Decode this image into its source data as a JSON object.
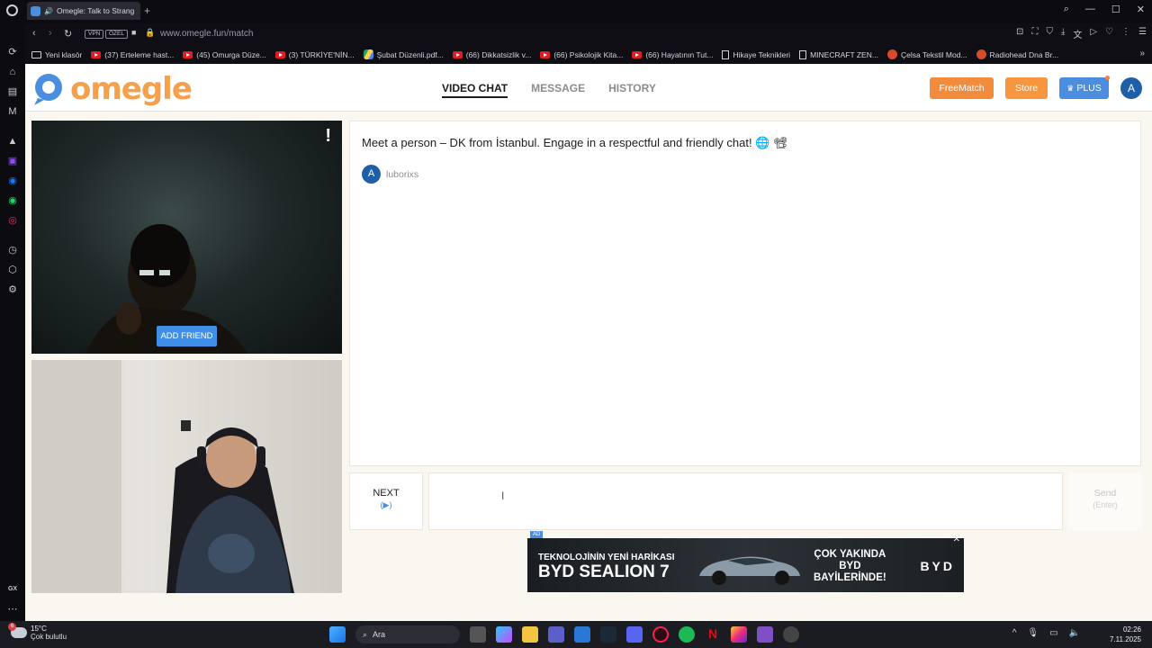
{
  "browser": {
    "tab_title": "Omegle: Talk to Strang",
    "url": "www.omegle.fun/match",
    "vpn_label": "VPN",
    "private_label": "ÖZEL",
    "bookmarks": [
      {
        "label": "Yeni klasör",
        "icon": "folder-icon"
      },
      {
        "label": "(37) Erteleme hast...",
        "icon": "youtube-icon"
      },
      {
        "label": "(45) Omurga Düze...",
        "icon": "youtube-icon"
      },
      {
        "label": "(3) TÜRKİYE'NİN...",
        "icon": "youtube-icon"
      },
      {
        "label": "Şubat Düzenli.pdf...",
        "icon": "drive-icon"
      },
      {
        "label": "(66) Dikkatsizlik v...",
        "icon": "youtube-icon"
      },
      {
        "label": "(66) Psikolojik Kita...",
        "icon": "youtube-icon"
      },
      {
        "label": "(66) Hayatının Tut...",
        "icon": "youtube-icon"
      },
      {
        "label": "Hikaye Teknikleri",
        "icon": "document-icon"
      },
      {
        "label": "MINECRAFT ZEN...",
        "icon": "document-icon"
      },
      {
        "label": "Çelsa Tekstil Mod...",
        "icon": "site-icon"
      },
      {
        "label": "Radiohead Dna Br...",
        "icon": "site-icon"
      }
    ],
    "sidebar_label": "GX"
  },
  "site": {
    "logo_text": "omegle",
    "nav": {
      "video_chat": "VIDEO CHAT",
      "message": "MESSAGE",
      "history": "HISTORY"
    },
    "buttons": {
      "freematch": "FreeMatch",
      "store": "Store",
      "plus": "PLUS"
    },
    "avatar_letter": "A",
    "colors": {
      "brand_orange": "#f7a04c",
      "accent_blue": "#3f8fe6",
      "avatar_blue": "#1f5fa8"
    }
  },
  "video": {
    "report_symbol": "!",
    "add_friend": "ADD FRIEND"
  },
  "chat": {
    "intro": "Meet a person – DK from İstanbul. Engage in a respectful and friendly chat! 🌐 📽",
    "user_letter": "A",
    "user_name": "luborixs",
    "next_label": "NEXT",
    "next_hint": "(▶)",
    "send_label": "Send",
    "send_hint": "(Enter)"
  },
  "ad": {
    "tag": "AD",
    "close": "✕",
    "line1": "TEKNOLOJİNİN YENİ HARİKASI",
    "line2": "BYD SEALION 7",
    "right_1": "ÇOK YAKINDA",
    "right_2": "BYD",
    "right_3": "BAYİLERİNDE!",
    "brand": "BYD"
  },
  "taskbar": {
    "temp": "15°C",
    "weather": "Çok bulutlu",
    "weather_badge": "6",
    "search": "Ara",
    "time": "02:26",
    "date": "7.11.2025"
  }
}
